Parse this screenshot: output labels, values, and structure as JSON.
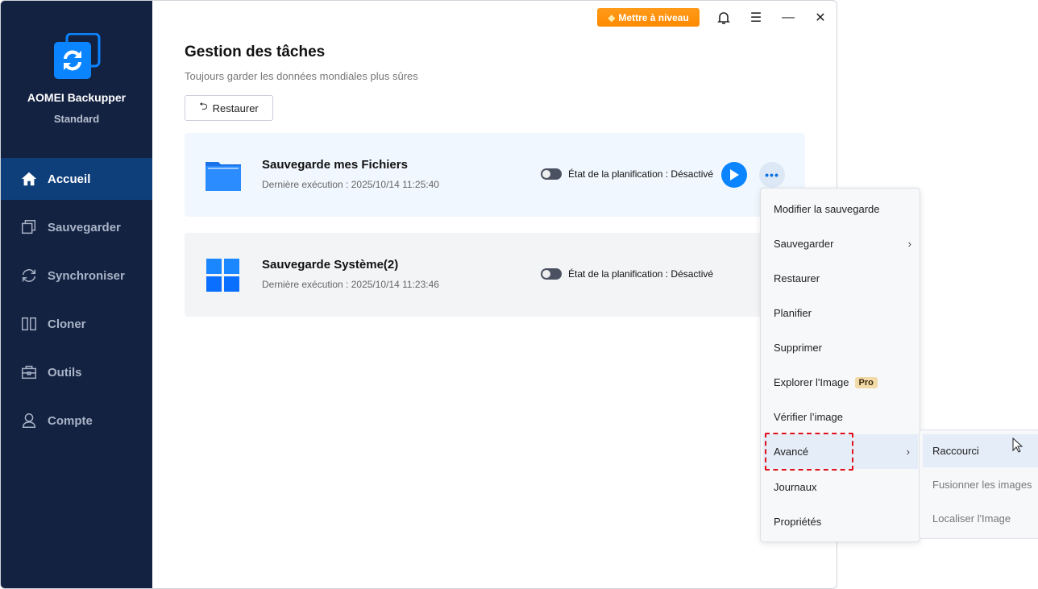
{
  "app": {
    "name": "AOMEI Backupper",
    "edition": "Standard"
  },
  "sidebar": {
    "items": [
      {
        "label": "Accueil"
      },
      {
        "label": "Sauvegarder"
      },
      {
        "label": "Synchroniser"
      },
      {
        "label": "Cloner"
      },
      {
        "label": "Outils"
      },
      {
        "label": "Compte"
      }
    ]
  },
  "titlebar": {
    "upgrade_label": "Mettre à niveau"
  },
  "main": {
    "title": "Gestion des tâches",
    "subtitle": "Toujours garder les données mondiales plus sûres",
    "restore_label": "Restaurer",
    "tasks": [
      {
        "name": "Sauvegarde mes Fichiers",
        "last_run": "Dernière exécution : 2025/10/14 11:25:40",
        "schedule": "État de la planification : Désactivé"
      },
      {
        "name": "Sauvegarde Système(2)",
        "last_run": "Dernière exécution : 2025/10/14 11:23:46",
        "schedule": "État de la planification : Désactivé"
      }
    ]
  },
  "menu": {
    "items": [
      {
        "label": "Modifier la sauvegarde"
      },
      {
        "label": "Sauvegarder"
      },
      {
        "label": "Restaurer"
      },
      {
        "label": "Planifier"
      },
      {
        "label": "Supprimer"
      },
      {
        "label": "Explorer l'Image",
        "badge": "Pro"
      },
      {
        "label": "Vérifier l’image"
      },
      {
        "label": "Avancé"
      },
      {
        "label": "Journaux"
      },
      {
        "label": "Propriétés"
      }
    ]
  },
  "submenu": {
    "items": [
      {
        "label": "Raccourci"
      },
      {
        "label": "Fusionner les images"
      },
      {
        "label": "Localiser l'Image"
      }
    ]
  },
  "colors": {
    "sidebar": "#142242",
    "accent": "#0a84ff",
    "upgrade": "#ff9000"
  }
}
